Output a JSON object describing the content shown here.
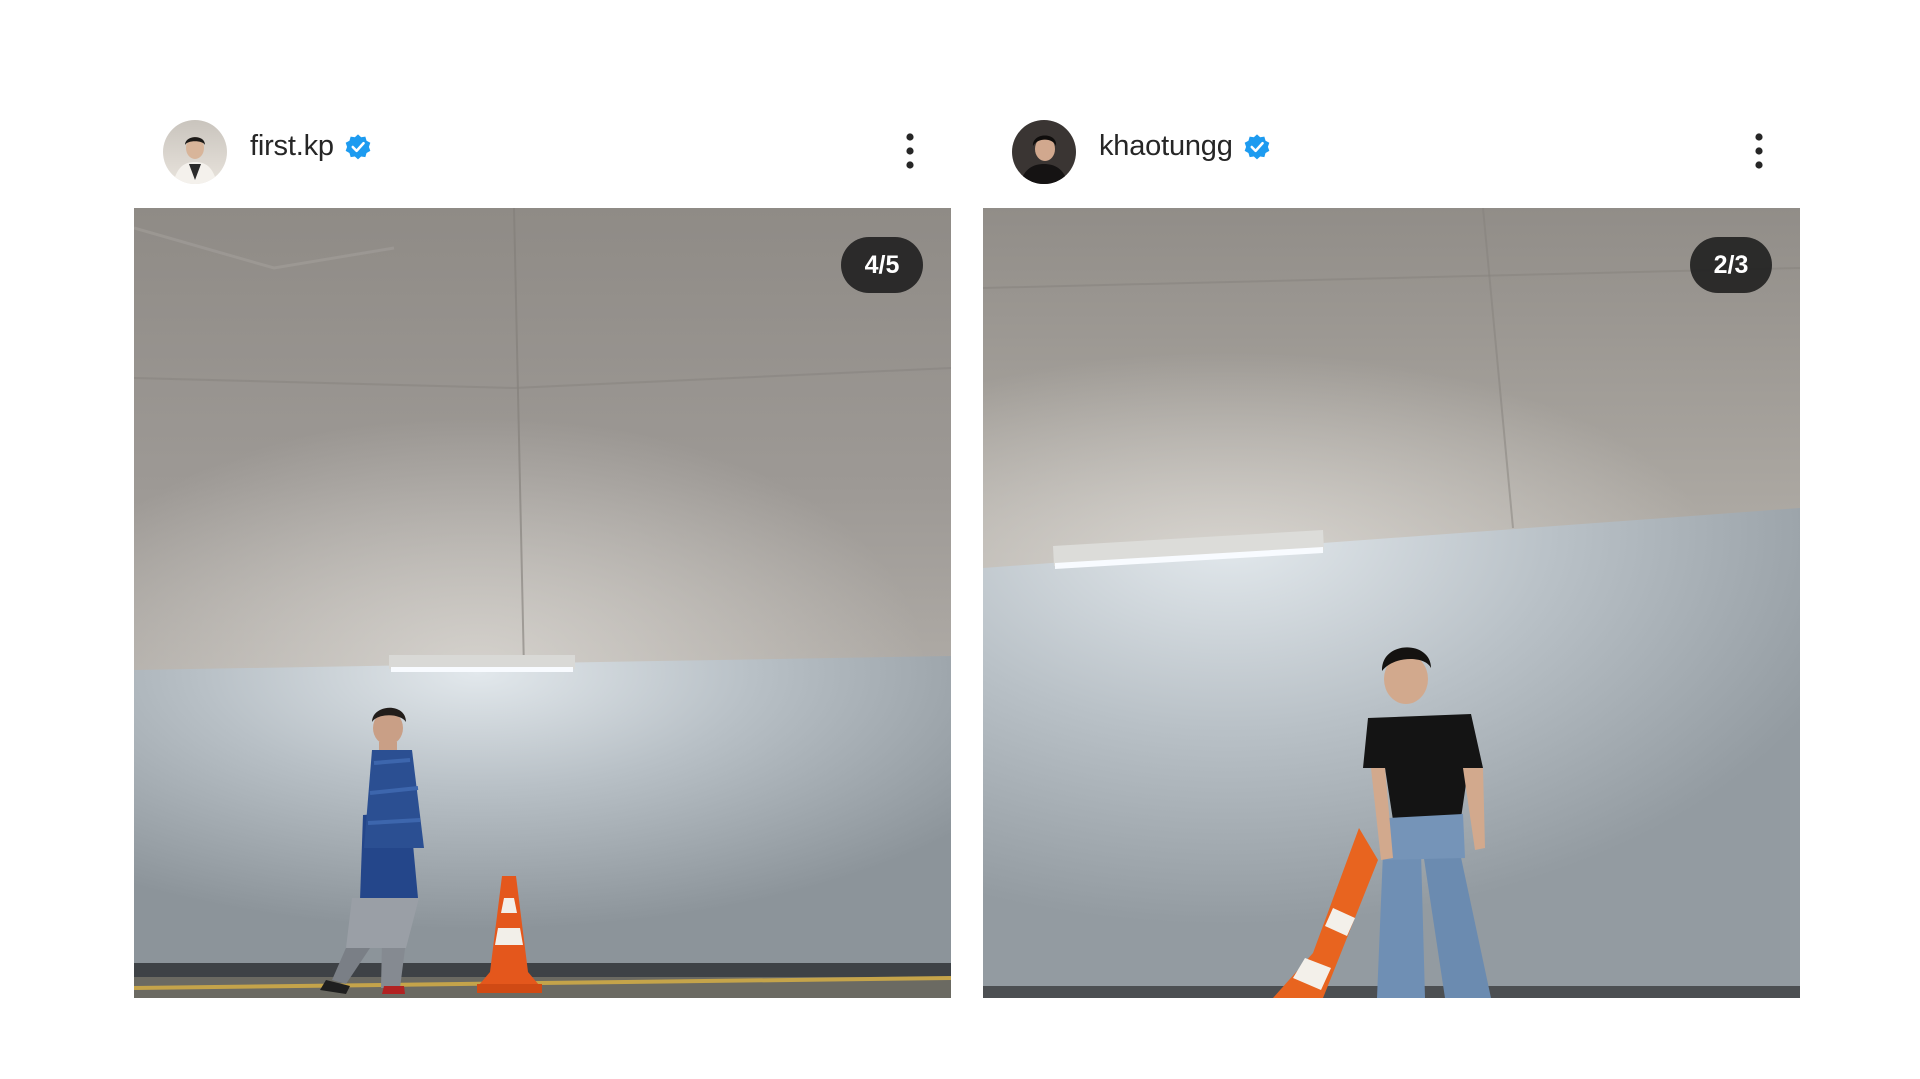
{
  "posts": [
    {
      "username": "first.kp",
      "verified": true,
      "counter": "4/5",
      "avatar_icon": "profile-avatar",
      "more_icon": "more-options-vertical-icon"
    },
    {
      "username": "khaotungg",
      "verified": true,
      "counter": "2/3",
      "avatar_icon": "profile-avatar",
      "more_icon": "more-options-vertical-icon"
    }
  ],
  "colors": {
    "verified_badge": "#1d9bf0",
    "username_text": "#262626",
    "counter_bg": "#1c1c1c",
    "background": "#ffffff"
  }
}
